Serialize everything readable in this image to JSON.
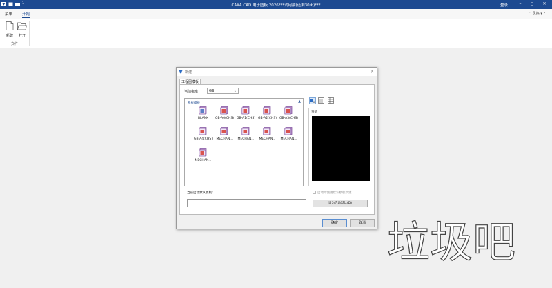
{
  "titlebar": {
    "title": "CAXA CAD 电子图板 2026***试用期(还剩30天)***",
    "login": "登录",
    "minimize": "–",
    "restore": "◻",
    "close": "✕",
    "quick_number": "1"
  },
  "menu": {
    "tabs": [
      {
        "label": "菜单"
      },
      {
        "label": "开始"
      }
    ],
    "share": "^ 风格 ▾ ?"
  },
  "ribbon": {
    "new_label": "新建",
    "open_label": "打开",
    "group_label": "文件"
  },
  "dialog": {
    "title": "新建",
    "close": "×",
    "tab": "工程图模板",
    "standard_label": "当前标准",
    "standard_value": "GB",
    "standard_arrow": "⌄",
    "template_group": "系统模板",
    "collapse": "▲",
    "templates": [
      {
        "name": "BLANK"
      },
      {
        "name": "GB-A0(CHS)"
      },
      {
        "name": "GB-A1(CHS)"
      },
      {
        "name": "GB-A2(CHS)"
      },
      {
        "name": "GB-A3(CHS)"
      },
      {
        "name": "GB-A4(CHS)"
      },
      {
        "name": "MECHAN..."
      },
      {
        "name": "MECHAN..."
      },
      {
        "name": "MECHAN..."
      },
      {
        "name": "MECHAN..."
      },
      {
        "name": "MECHAN..."
      }
    ],
    "preview_label": "预览",
    "startup_checkbox": "启动时使用默认模板新建",
    "default_label": "当前启动默认模板:",
    "default_value": "",
    "set_default_button": "设为启动默认(D)",
    "ok_button": "确定",
    "cancel_button": "取消"
  },
  "watermark_text": "垃圾吧",
  "colors": {
    "titlebar": "#1d4a91",
    "accent": "#1d4a91",
    "preview": "#000000"
  }
}
